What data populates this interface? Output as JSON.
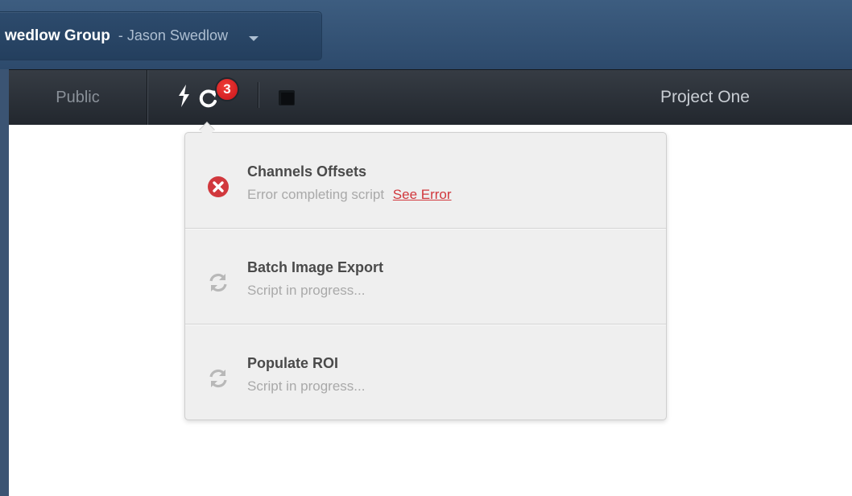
{
  "header": {
    "group_name": "wedlow Group",
    "user_name": "- Jason Swedlow"
  },
  "nav": {
    "public_tab": "Public",
    "activity_count": "3",
    "project_title": "Project One"
  },
  "activities": [
    {
      "title": "Channels Offsets",
      "status": "Error completing script",
      "link": "See Error",
      "state": "error"
    },
    {
      "title": "Batch Image Export",
      "status": "Script in progress...",
      "state": "in-progress"
    },
    {
      "title": "Populate ROI",
      "status": "Script in progress...",
      "state": "in-progress"
    }
  ],
  "colors": {
    "header_bg": "#2d4a6c",
    "nav_bg": "#2a2f36",
    "badge": "#d9201f",
    "error": "#d1383d"
  },
  "icons": {
    "script": "lightning-script-icon",
    "activity": "refresh-activity-icon",
    "folder": "folder-icon",
    "error": "error-x-circle-icon",
    "progress": "sync-icon"
  }
}
